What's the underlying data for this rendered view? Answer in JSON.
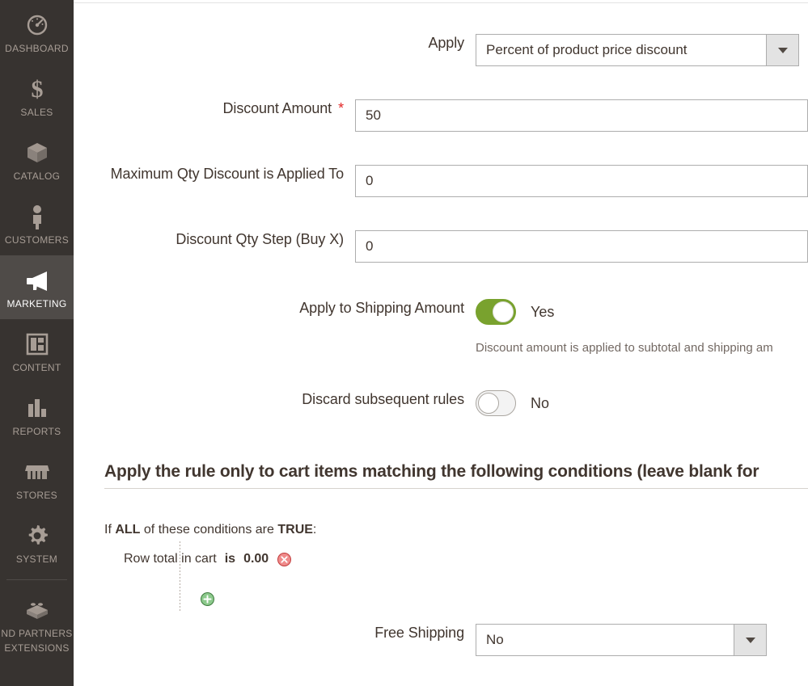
{
  "sidebar": {
    "items": [
      {
        "label": "DASHBOARD",
        "icon": "dashboard-icon",
        "active": false
      },
      {
        "label": "SALES",
        "icon": "dollar-icon",
        "active": false
      },
      {
        "label": "CATALOG",
        "icon": "box-icon",
        "active": false
      },
      {
        "label": "CUSTOMERS",
        "icon": "person-icon",
        "active": false
      },
      {
        "label": "MARKETING",
        "icon": "megaphone-icon",
        "active": true
      },
      {
        "label": "CONTENT",
        "icon": "layout-icon",
        "active": false
      },
      {
        "label": "REPORTS",
        "icon": "bar-chart-icon",
        "active": false
      },
      {
        "label": "STORES",
        "icon": "storefront-icon",
        "active": false
      },
      {
        "label": "SYSTEM",
        "icon": "gear-icon",
        "active": false
      }
    ],
    "extensions": {
      "label_line1": "ND PARTNERS",
      "label_line2": "EXTENSIONS",
      "icon": "brick-icon"
    }
  },
  "form": {
    "apply": {
      "label": "Apply",
      "value": "Percent of product price discount"
    },
    "discount_amount": {
      "label": "Discount Amount",
      "required_marker": "*",
      "value": "50"
    },
    "max_qty": {
      "label": "Maximum Qty Discount is Applied To",
      "value": "0"
    },
    "qty_step": {
      "label": "Discount Qty Step (Buy X)",
      "value": "0"
    },
    "apply_to_shipping": {
      "label": "Apply to Shipping Amount",
      "state": "Yes",
      "note": "Discount amount is applied to subtotal and shipping am"
    },
    "discard_subsequent": {
      "label": "Discard subsequent rules",
      "state": "No"
    },
    "free_shipping": {
      "label": "Free Shipping",
      "value": "No"
    }
  },
  "conditions": {
    "section_title": "Apply the rule only to cart items matching the following conditions (leave blank for",
    "intro_prefix": "If",
    "intro_aggregator": "ALL",
    "intro_middle": "of these conditions are",
    "intro_value": "TRUE",
    "intro_suffix": ":",
    "rows": [
      {
        "attribute": "Row total in cart",
        "operator": "is",
        "value": "0.00",
        "remove_icon": "remove-circle-icon"
      }
    ],
    "add_icon": "add-circle-icon"
  },
  "colors": {
    "sidebar_bg": "#373330",
    "sidebar_active_bg": "#4f4b48",
    "toggle_on": "#79a22e",
    "required_star": "#e22626",
    "remove_icon": "#e04f4f",
    "add_icon": "#4a9a4a"
  }
}
